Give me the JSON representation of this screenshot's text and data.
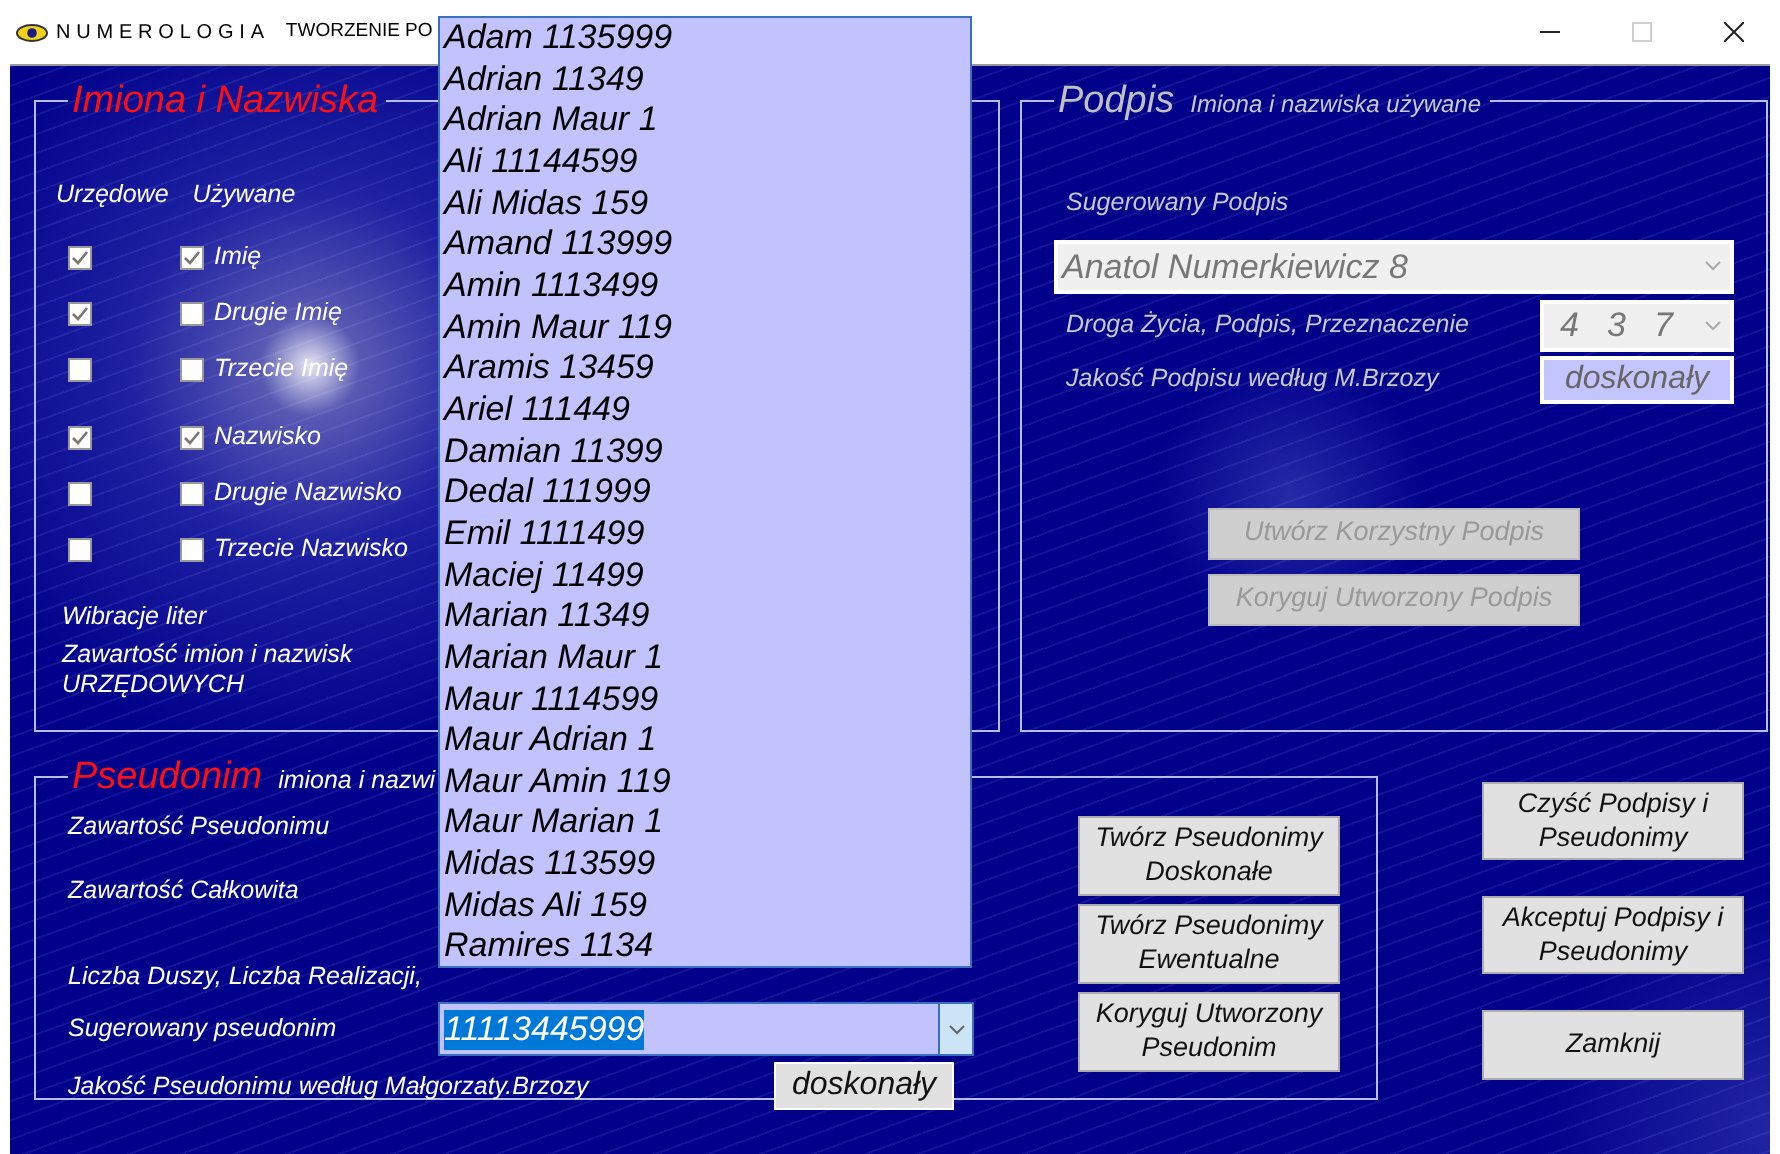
{
  "window": {
    "app_name": "NUMEROLOGIA",
    "title": "TWORZENIE PO",
    "controls": [
      {
        "kind": "minimize",
        "disabled": false
      },
      {
        "kind": "maximize",
        "disabled": true
      },
      {
        "kind": "close",
        "disabled": false
      }
    ]
  },
  "names_panel": {
    "title": "Imiona i Nazwiska",
    "column_headers": [
      "Urzędowe",
      "Używane"
    ],
    "rows": [
      {
        "label": "Imię",
        "official": true,
        "used": true
      },
      {
        "label": "Drugie Imię",
        "official": true,
        "used": false
      },
      {
        "label": "Trzecie Imię",
        "official": false,
        "used": false
      },
      {
        "label": "Nazwisko",
        "official": true,
        "used": true
      },
      {
        "label": "Drugie Nazwisko",
        "official": false,
        "used": false
      },
      {
        "label": "Trzecie Nazwisko",
        "official": false,
        "used": false
      }
    ],
    "notes": [
      "Wibracje liter",
      "Zawartość imion i nazwisk\nURZĘDOWYCH"
    ]
  },
  "signature_panel": {
    "title": "Podpis",
    "subtitle": "Imiona i nazwiska używane",
    "suggested_label": "Sugerowany Podpis",
    "suggested": {
      "value": "Anatol Numerkiewicz 8",
      "disabled": true
    },
    "numbers_label": "Droga Życia, Podpis, Przeznaczenie",
    "numbers": {
      "values": [
        "4",
        "3",
        "7"
      ],
      "disabled": true
    },
    "quality_label": "Jakość Podpisu według M.Brzozy",
    "quality": "doskonały",
    "buttons": [
      {
        "label": "Utwórz Korzystny Podpis",
        "disabled": true
      },
      {
        "label": "Koryguj Utworzony Podpis",
        "disabled": true
      }
    ]
  },
  "pseudonym_panel": {
    "title": "Pseudonim",
    "subtitle": "imiona i nazwi",
    "labels": [
      "Zawartość Pseudonimu",
      "Zawartość Całkowita",
      "Liczba Duszy, Liczba Realizacji,"
    ],
    "suggested_label": "Sugerowany pseudonim",
    "suggested": {
      "value": "11113445999",
      "highlighted": true
    },
    "dropdown": [
      "Adam 1135999",
      "Adrian 11349",
      "Adrian Maur 1",
      "Ali 11144599",
      "Ali Midas 159",
      "Amand 113999",
      "Amin 1113499",
      "Amin Maur 119",
      "Aramis 13459",
      "Ariel 111449",
      "Damian 11399",
      "Dedal 111999",
      "Emil 1111499",
      "Maciej 11499",
      "Marian 11349",
      "Marian Maur 1",
      "Maur 1114599",
      "Maur Adrian 1",
      "Maur Amin 119",
      "Maur Marian 1",
      "Midas 113599",
      "Midas Ali 159",
      "Ramires 1134"
    ],
    "quality_label": "Jakość Pseudonimu według Małgorzaty.Brzozy",
    "quality": "doskonały",
    "buttons": [
      {
        "label": "Twórz Pseudonimy Doskonałe",
        "disabled": false
      },
      {
        "label": "Twórz Pseudonimy Ewentualne",
        "disabled": false
      },
      {
        "label": "Koryguj Utworzony Pseudonim",
        "disabled": false
      }
    ]
  },
  "actions": [
    {
      "label": "Czyść Podpisy i Pseudonimy",
      "disabled": false
    },
    {
      "label": "Akceptuj Podpisy i Pseudonimy",
      "disabled": false
    },
    {
      "label": "Zamknij",
      "disabled": false
    }
  ]
}
